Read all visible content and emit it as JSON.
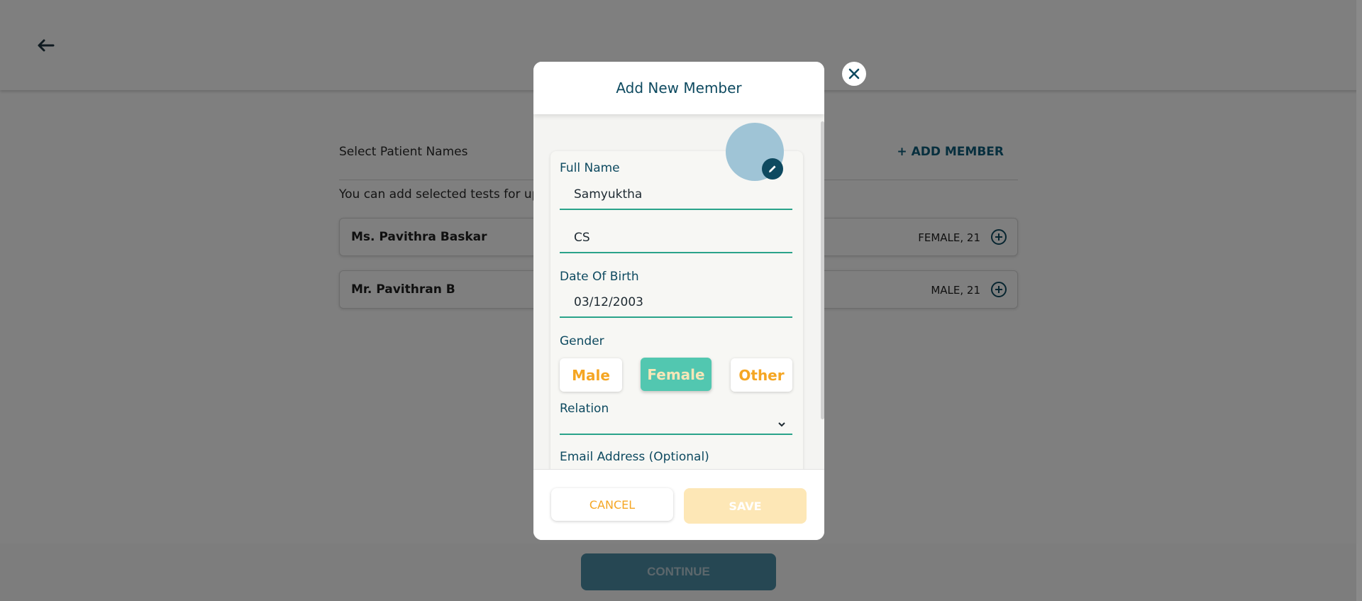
{
  "colors": {
    "primary": "#0e4a60",
    "accent": "#2aa38a",
    "gender_selected": "#52c7b0",
    "orange": "#f5a623",
    "save_disabled": "#fde7b6",
    "continue_disabled": "#4d8ea6"
  },
  "header": {
    "back_icon": "arrow-left-icon"
  },
  "page": {
    "select_title": "Select Patient Names",
    "add_member_label": "+ ADD MEMBER",
    "hint": "You can add selected tests for up",
    "patients": [
      {
        "name": "Ms. Pavithra Baskar",
        "meta": "FEMALE, 21"
      },
      {
        "name": "Mr. Pavithran B",
        "meta": "MALE, 21"
      }
    ],
    "continue_label": "CONTINUE"
  },
  "modal": {
    "title": "Add New Member",
    "full_name_label": "Full Name",
    "first_name_value": "Samyuktha",
    "last_name_value": "CS",
    "dob_label": "Date Of Birth",
    "dob_value": "03/12/2003",
    "gender_label": "Gender",
    "gender_options": [
      "Male",
      "Female",
      "Other"
    ],
    "gender_selected": "Female",
    "relation_label": "Relation",
    "relation_value": "",
    "email_label": "Email Address (Optional)",
    "cancel_label": "CANCEL",
    "save_label": "SAVE"
  }
}
